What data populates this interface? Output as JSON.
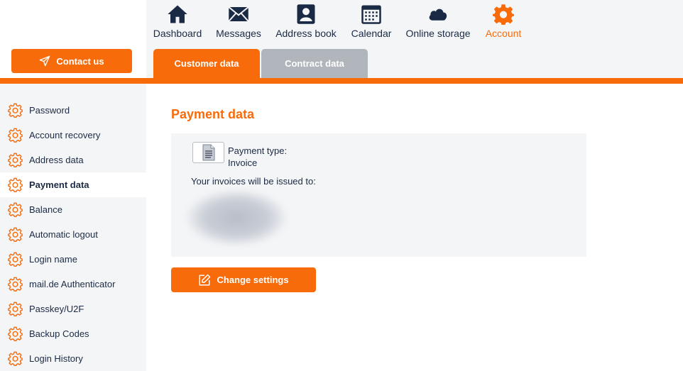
{
  "colors": {
    "accent": "#f76b0a",
    "text": "#1b2a44",
    "panel": "#f4f5f7",
    "tab_inactive": "#b1b5bc"
  },
  "contact_button": {
    "label": "Contact us",
    "icon": "paper-plane-icon"
  },
  "nav": {
    "items": [
      {
        "label": "Dashboard",
        "icon": "home-icon"
      },
      {
        "label": "Messages",
        "icon": "envelope-icon"
      },
      {
        "label": "Address book",
        "icon": "contact-card-icon"
      },
      {
        "label": "Calendar",
        "icon": "calendar-icon"
      },
      {
        "label": "Online storage",
        "icon": "cloud-icon"
      },
      {
        "label": "Account",
        "icon": "gear-icon",
        "active": true
      }
    ]
  },
  "tabs": [
    {
      "label": "Customer data",
      "active": true
    },
    {
      "label": "Contract data",
      "active": false
    }
  ],
  "sidebar": {
    "items": [
      {
        "label": "Password"
      },
      {
        "label": "Account recovery"
      },
      {
        "label": "Address data"
      },
      {
        "label": "Payment data",
        "active": true
      },
      {
        "label": "Balance"
      },
      {
        "label": "Automatic logout"
      },
      {
        "label": "Login name"
      },
      {
        "label": "mail.de Authenticator"
      },
      {
        "label": "Passkey/U2F"
      },
      {
        "label": "Backup Codes"
      },
      {
        "label": "Login History"
      }
    ]
  },
  "main": {
    "title": "Payment data",
    "payment_type_label": "Payment type:",
    "payment_type_value": "Invoice",
    "issued_to_label": "Your invoices will be issued to:",
    "change_button_label": "Change settings"
  }
}
